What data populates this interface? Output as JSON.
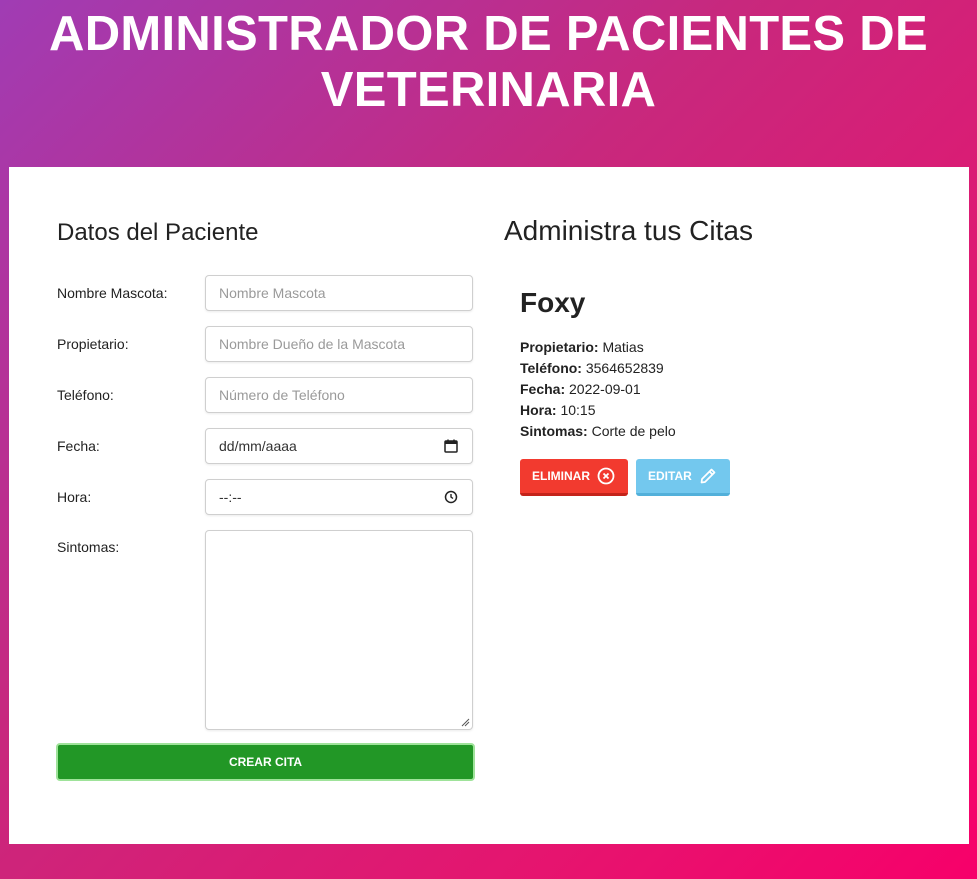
{
  "header": {
    "title_line1": "ADMINISTRADOR DE PACIENTES DE",
    "title_line2": "VETERINARIA"
  },
  "form": {
    "title": "Datos del Paciente",
    "fields": [
      {
        "label": "Nombre Mascota:",
        "placeholder": "Nombre Mascota"
      },
      {
        "label": "Propietario:",
        "placeholder": "Nombre Dueño de la Mascota"
      },
      {
        "label": "Teléfono:",
        "placeholder": "Número de Teléfono"
      },
      {
        "label": "Fecha:",
        "placeholder": "dd/mm/aaaa",
        "icon": "calendar-icon"
      },
      {
        "label": "Hora:",
        "placeholder": "--:--",
        "icon": "clock-icon"
      },
      {
        "label": "Sintomas:",
        "value": ""
      }
    ],
    "submit_label": "CREAR CITA"
  },
  "appointments": {
    "title": "Administra tus Citas",
    "items": [
      {
        "pet": "Foxy",
        "owner_label": "Propietario:",
        "owner": "Matias",
        "phone_label": "Teléfono:",
        "phone": "3564652839",
        "date_label": "Fecha:",
        "date": "2022-09-01",
        "time_label": "Hora:",
        "time": "10:15",
        "symptoms_label": "Sintomas:",
        "symptoms": "Corte de pelo",
        "delete_label": "ELIMINAR",
        "edit_label": "EDITAR"
      }
    ]
  },
  "colors": {
    "submit": "#229726",
    "delete": "#f23a2f",
    "edit": "#73c8ee"
  }
}
